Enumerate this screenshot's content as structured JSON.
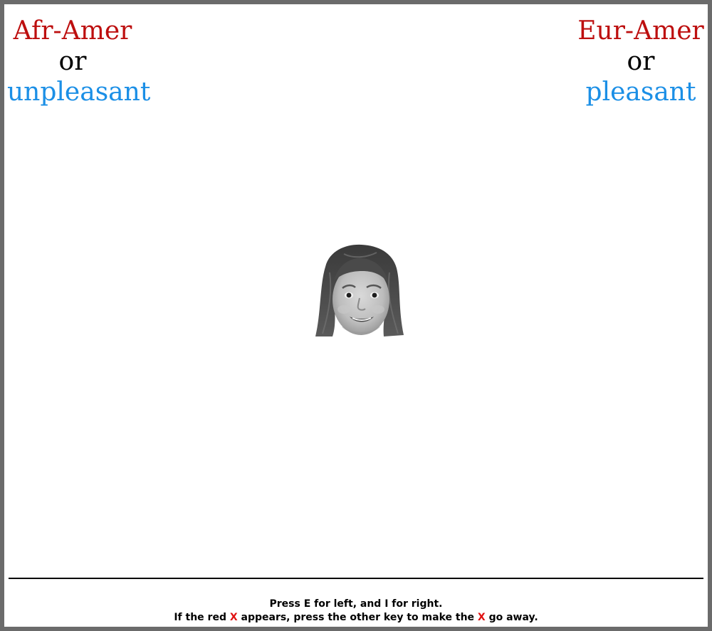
{
  "left_category": {
    "primary": "Afr-Amer",
    "joiner": "or",
    "secondary": "unpleasant"
  },
  "right_category": {
    "primary": "Eur-Amer",
    "joiner": "or",
    "secondary": "pleasant"
  },
  "stimulus": {
    "type": "face-photo",
    "description_icon": "child-face-image"
  },
  "instructions": {
    "line1": "Press E for left, and I for right.",
    "line2_part1": "If the red ",
    "x_mark": "X",
    "line2_part2": " appears, press the other key to make the ",
    "x_mark_2": "X",
    "line2_part3": " go away."
  },
  "colors": {
    "primary_category": "#bd0f0f",
    "secondary_category": "#1b8fe6",
    "error_x": "#e01010",
    "border": "#6b6b6b"
  }
}
